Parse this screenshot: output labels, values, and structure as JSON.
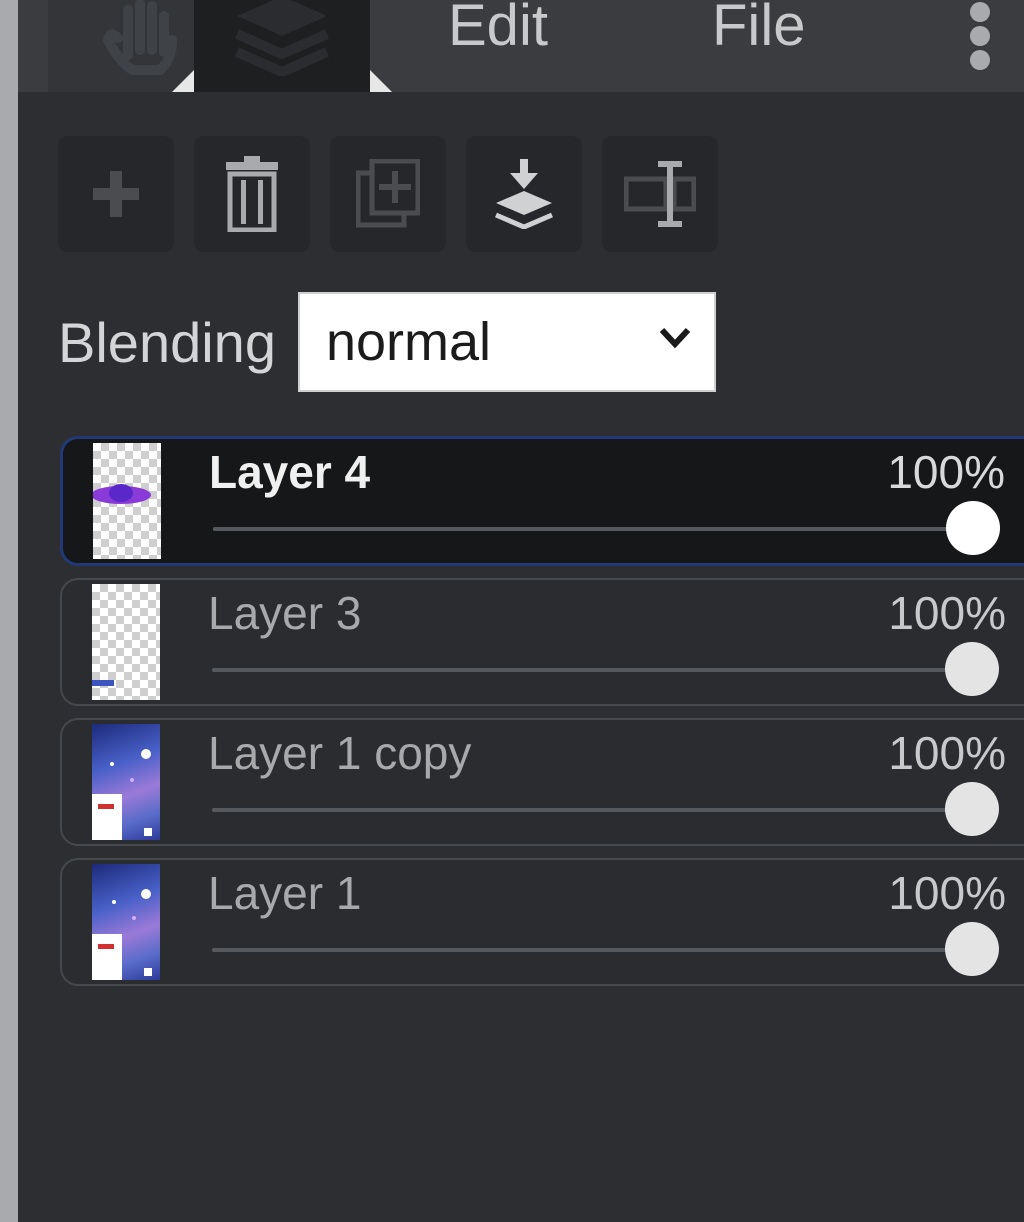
{
  "topbar": {
    "tabs": [
      {
        "icon": "hand-icon"
      },
      {
        "icon": "layers-icon"
      }
    ],
    "menu_edit": "Edit",
    "menu_file": "File",
    "more_icon": "kebab-menu-icon"
  },
  "toolbar": {
    "buttons": [
      {
        "icon": "plus-icon"
      },
      {
        "icon": "trash-icon"
      },
      {
        "icon": "duplicate-icon"
      },
      {
        "icon": "merge-down-icon"
      },
      {
        "icon": "rename-icon"
      }
    ]
  },
  "blending": {
    "label": "Blending",
    "value": "normal"
  },
  "layers": [
    {
      "name": "Layer 4",
      "opacity_label": "100%",
      "opacity": 100,
      "selected": true
    },
    {
      "name": "Layer 3",
      "opacity_label": "100%",
      "opacity": 100,
      "selected": false
    },
    {
      "name": "Layer 1 copy",
      "opacity_label": "100%",
      "opacity": 100,
      "selected": false
    },
    {
      "name": "Layer 1",
      "opacity_label": "100%",
      "opacity": 100,
      "selected": false
    }
  ],
  "colors": {
    "panel_bg": "#2c2e32",
    "selected_row_bg": "#161718",
    "selected_border": "#213a77",
    "slider_thumb": "#e4e4e4"
  }
}
